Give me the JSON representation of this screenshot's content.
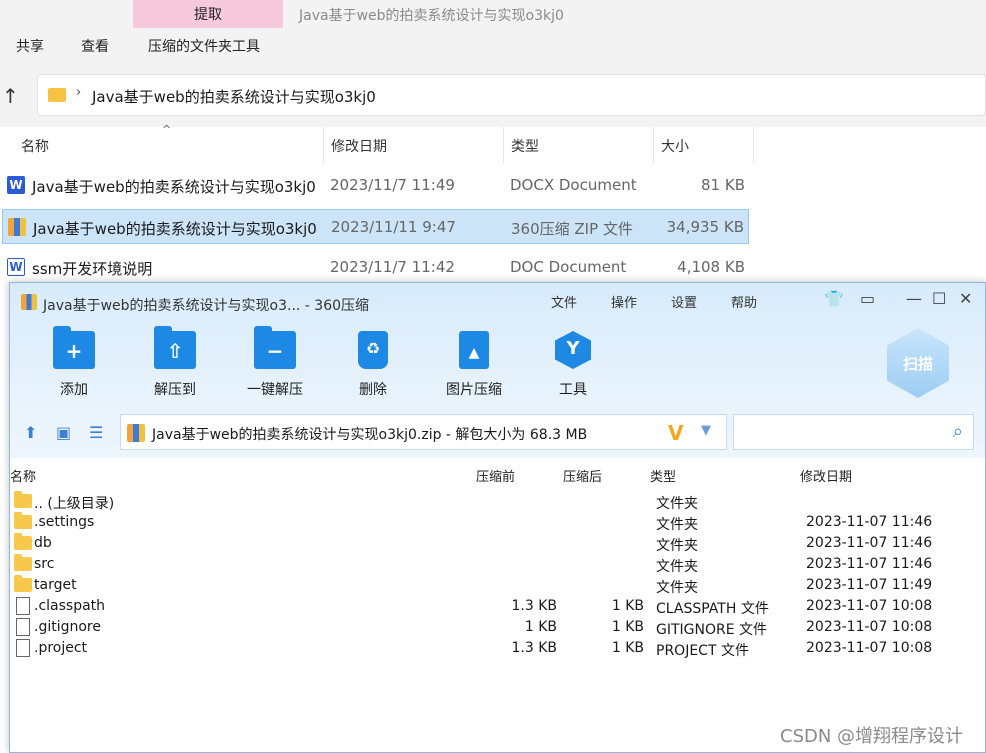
{
  "explorer": {
    "extract_tab": "提取",
    "window_title": "Java基于web的拍卖系统设计与实现o3kj0",
    "menu": [
      "共享",
      "查看",
      "压缩的文件夹工具"
    ],
    "address_path": "Java基于web的拍卖系统设计与实现o3kj0",
    "columns": [
      "名称",
      "修改日期",
      "类型",
      "大小"
    ],
    "files": [
      {
        "name": "Java基于web的拍卖系统设计与实现o3kj0",
        "date": "2023/11/7 11:49",
        "type": "DOCX Document",
        "size": "81 KB",
        "icon": "word-icon",
        "selected": false
      },
      {
        "name": "Java基于web的拍卖系统设计与实现o3kj0",
        "date": "2023/11/11 9:47",
        "type": "360压缩 ZIP 文件",
        "size": "34,935 KB",
        "icon": "zip-icon",
        "selected": true
      },
      {
        "name": "ssm开发环境说明",
        "date": "2023/11/7 11:42",
        "type": "DOC Document",
        "size": "4,108 KB",
        "icon": "doc-icon",
        "selected": false
      }
    ]
  },
  "zip": {
    "title": "Java基于web的拍卖系统设计与实现o3... - 360压缩",
    "menu": [
      "文件",
      "操作",
      "设置",
      "帮助"
    ],
    "tools": [
      "添加",
      "解压到",
      "一键解压",
      "删除",
      "图片压缩",
      "工具"
    ],
    "scan_label": "扫描",
    "path_text": "Java基于web的拍卖系统设计与实现o3kj0.zip - 解包大小为 68.3 MB",
    "columns": [
      "名称",
      "压缩前",
      "压缩后",
      "类型",
      "修改日期"
    ],
    "rows": [
      {
        "name": ".. (上级目录)",
        "before": "",
        "after": "",
        "type": "文件夹",
        "date": "",
        "kind": "folder"
      },
      {
        "name": ".settings",
        "before": "",
        "after": "",
        "type": "文件夹",
        "date": "2023-11-07 11:46",
        "kind": "folder"
      },
      {
        "name": "db",
        "before": "",
        "after": "",
        "type": "文件夹",
        "date": "2023-11-07 11:46",
        "kind": "folder"
      },
      {
        "name": "src",
        "before": "",
        "after": "",
        "type": "文件夹",
        "date": "2023-11-07 11:46",
        "kind": "folder"
      },
      {
        "name": "target",
        "before": "",
        "after": "",
        "type": "文件夹",
        "date": "2023-11-07 11:49",
        "kind": "folder"
      },
      {
        "name": ".classpath",
        "before": "1.3 KB",
        "after": "1 KB",
        "type": "CLASSPATH 文件",
        "date": "2023-11-07 10:08",
        "kind": "file"
      },
      {
        "name": ".gitignore",
        "before": "1 KB",
        "after": "1 KB",
        "type": "GITIGNORE 文件",
        "date": "2023-11-07 10:08",
        "kind": "file"
      },
      {
        "name": ".project",
        "before": "1.3 KB",
        "after": "1 KB",
        "type": "PROJECT 文件",
        "date": "2023-11-07 10:08",
        "kind": "file"
      }
    ]
  },
  "watermark": "CSDN @增翔程序设计"
}
